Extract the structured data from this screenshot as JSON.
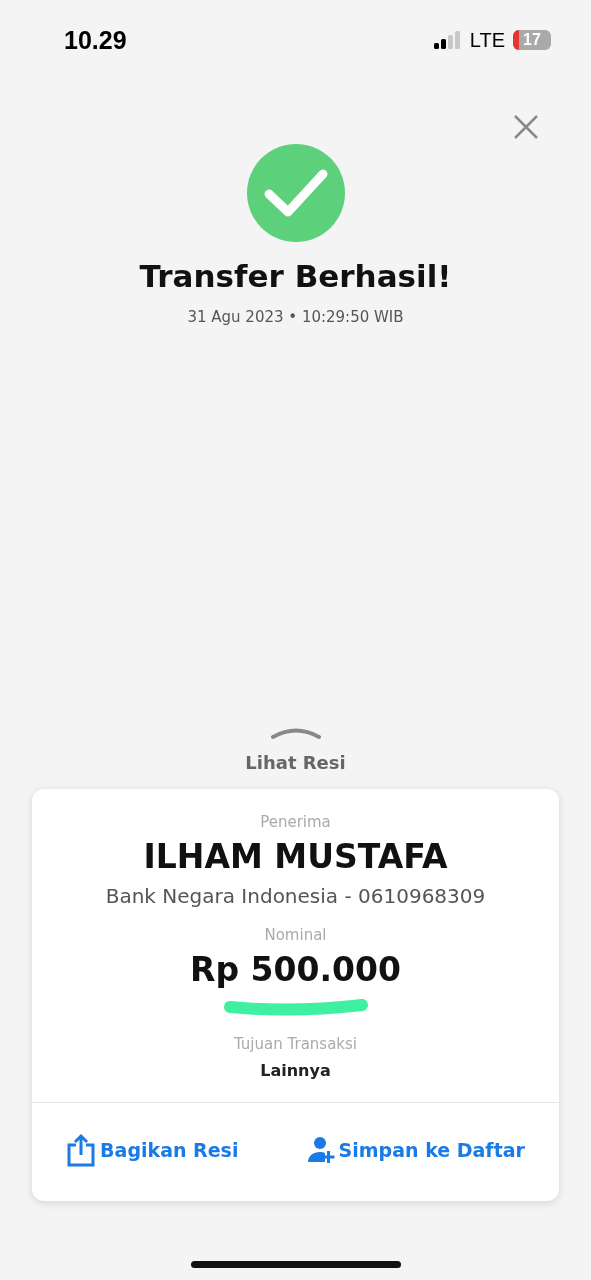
{
  "status_bar": {
    "time": "10.29",
    "network": "LTE",
    "battery": "17"
  },
  "header": {
    "title": "Transfer Berhasil!",
    "datetime": "31 Agu 2023 • 10:29:50 WIB"
  },
  "receipt_toggle": {
    "label": "Lihat Resi"
  },
  "receipt": {
    "fields": [
      {
        "kind": "name",
        "label": "Penerima",
        "value": "ILHAM MUSTAFA",
        "detail": "Bank Negara Indonesia - 0610968309"
      },
      {
        "kind": "amount",
        "label": "Nominal",
        "value": "Rp 500.000",
        "scribbled": true
      },
      {
        "kind": "plain",
        "label": "Tujuan Transaksi",
        "value": "Lainnya"
      }
    ],
    "actions": [
      {
        "kind": "share",
        "label": "Bagikan Resi"
      },
      {
        "kind": "save",
        "label": "Simpan ke Daftar"
      }
    ]
  }
}
